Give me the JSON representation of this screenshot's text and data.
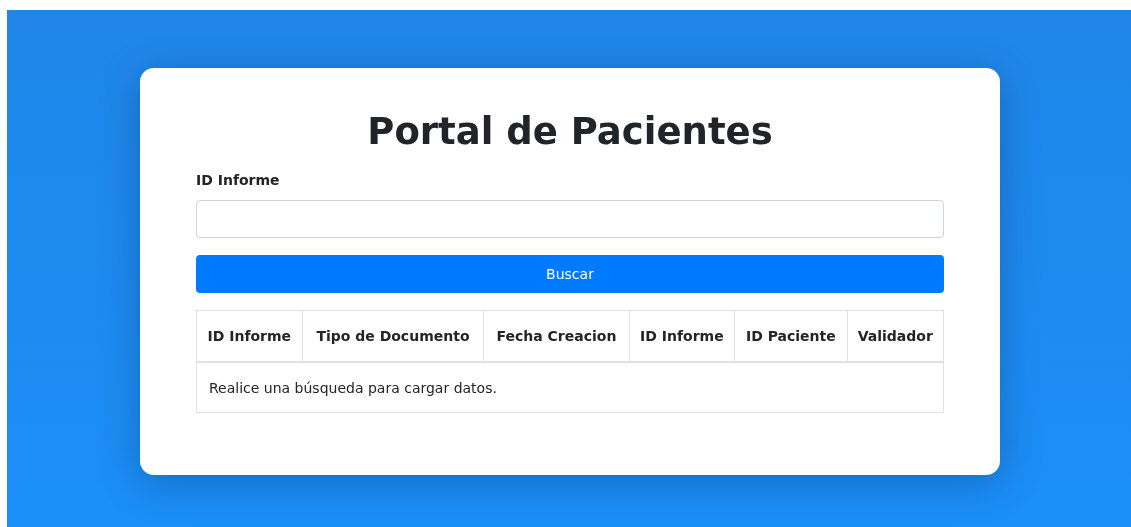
{
  "title": "Portal de Pacientes",
  "field": {
    "label": "ID Informe"
  },
  "button": "Buscar",
  "table": {
    "columns": [
      "ID Informe",
      "Tipo de Documento",
      "Fecha Creacion",
      "ID Informe",
      "ID Paciente",
      "Validador"
    ],
    "empty_message": "Realice una búsqueda para cargar datos."
  }
}
